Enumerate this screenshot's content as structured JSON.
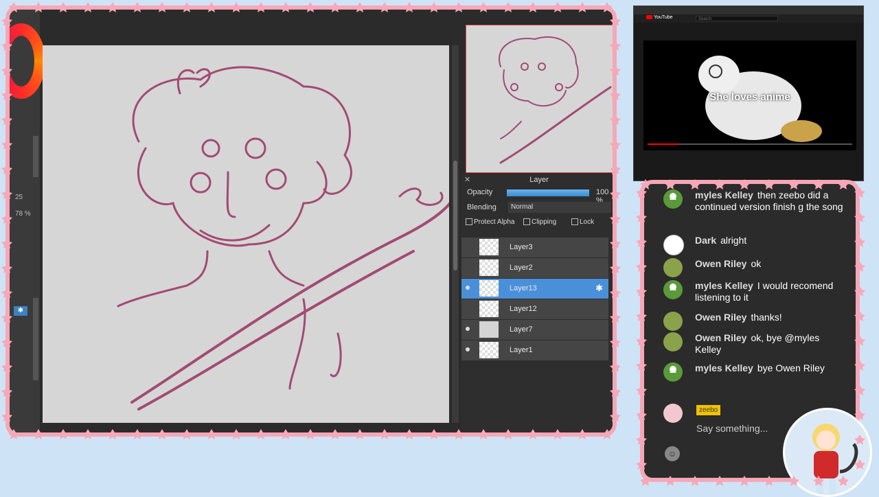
{
  "toolbar": {
    "brush_size": "25",
    "brush_percent": "78 %"
  },
  "layers_panel": {
    "title": "Layer",
    "opacity_label": "Opacity",
    "opacity_value": "100 %",
    "opacity_fraction": 1.0,
    "blending_label": "Blending",
    "blending_value": "Normal",
    "options": [
      "Protect Alpha",
      "Clipping",
      "Lock"
    ],
    "layers": [
      {
        "name": "Layer3",
        "visible": false,
        "active": false
      },
      {
        "name": "Layer2",
        "visible": false,
        "active": false
      },
      {
        "name": "Layer13",
        "visible": true,
        "active": true
      },
      {
        "name": "Layer12",
        "visible": false,
        "active": false
      },
      {
        "name": "Layer7",
        "visible": true,
        "active": false
      },
      {
        "name": "Layer1",
        "visible": true,
        "active": false
      }
    ]
  },
  "video": {
    "site": "YouTube",
    "search_placeholder": "Search",
    "caption": "She loves anime",
    "progress_fraction": 0.15
  },
  "chat": {
    "messages": [
      {
        "user": "myles Kelley",
        "text": "then zeebo did a continued version finish g the song",
        "avatar": "green"
      },
      {
        "user": "Dark",
        "text": "alright",
        "avatar": "dark"
      },
      {
        "user": "Owen Riley",
        "text": "ok",
        "avatar": "owen"
      },
      {
        "user": "myles Kelley",
        "text": "I would recomend listening to it",
        "avatar": "green"
      },
      {
        "user": "Owen Riley",
        "text": "thanks!",
        "avatar": "owen"
      },
      {
        "user": "Owen Riley",
        "text": "ok, bye @myles Kelley",
        "avatar": "owen"
      },
      {
        "user": "myles Kelley",
        "text": "bye Owen Riley",
        "avatar": "green"
      }
    ],
    "current_user": "zeebo",
    "input_placeholder": "Say something..."
  },
  "colors": {
    "frame": "#f6a7b6",
    "accent": "#4a90d9",
    "background": "#cfe3f7",
    "sketch": "#a24a72"
  }
}
